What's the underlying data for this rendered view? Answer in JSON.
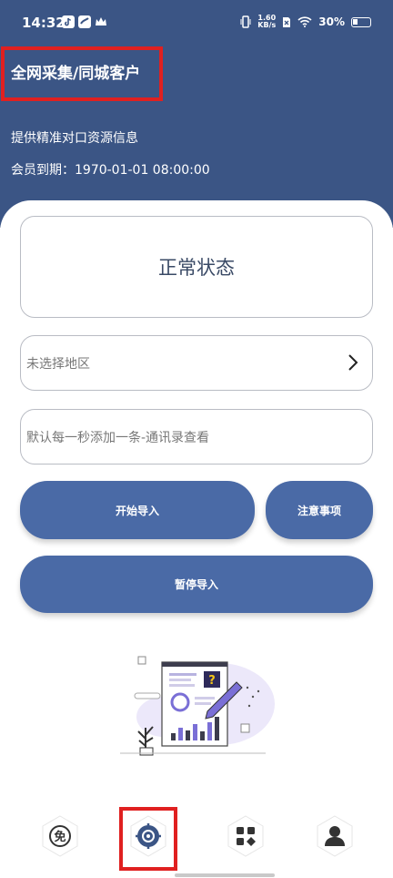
{
  "status_bar": {
    "time": "14:32",
    "speed_value": "1.60",
    "speed_unit": "KB/s",
    "battery": "30%"
  },
  "header": {
    "title": "全网采集/同城客户",
    "subtitle": "提供精准对口资源信息",
    "expiry_label": "会员到期：",
    "expiry_value": "1970-01-01 08:00:00"
  },
  "status_card": {
    "text": "正常状态"
  },
  "region_select": {
    "placeholder": "未选择地区"
  },
  "message_field": {
    "placeholder": "默认每一秒添加一条-通讯录查看"
  },
  "buttons": {
    "start": "开始导入",
    "notes": "注意事项",
    "pause": "暂停导入"
  },
  "bottom_nav": {
    "items": [
      {
        "icon": "free-icon",
        "glyph": "免"
      },
      {
        "icon": "target-icon"
      },
      {
        "icon": "apps-icon"
      },
      {
        "icon": "profile-icon"
      }
    ]
  },
  "colors": {
    "header": "#3b5585",
    "button": "#4a6aa6",
    "highlight": "#e02020"
  }
}
